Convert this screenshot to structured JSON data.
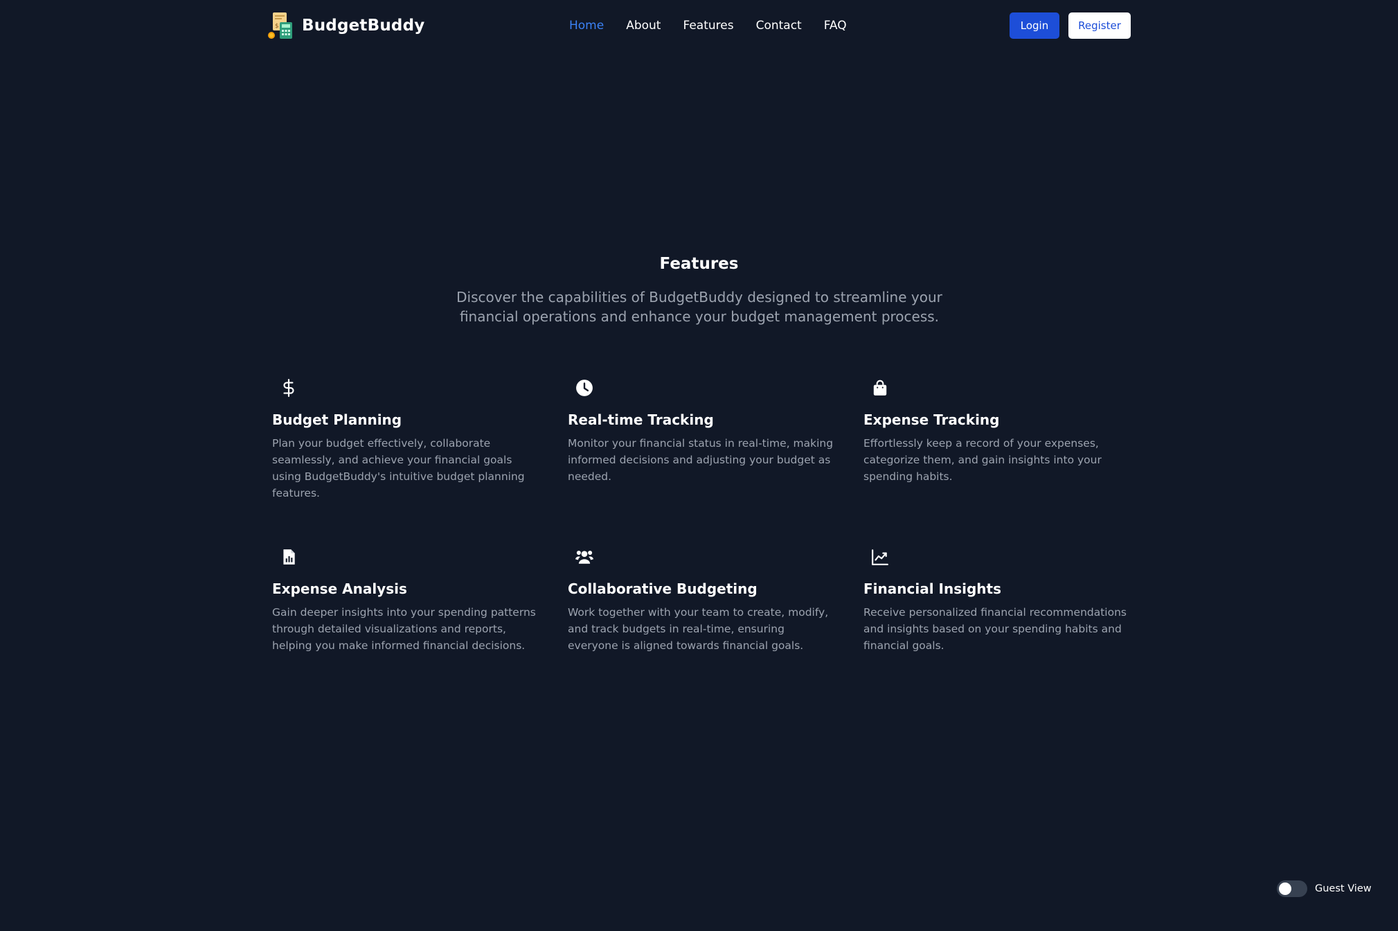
{
  "header": {
    "brand_name": "BudgetBuddy",
    "nav": [
      {
        "label": "Home",
        "active": true
      },
      {
        "label": "About",
        "active": false
      },
      {
        "label": "Features",
        "active": false
      },
      {
        "label": "Contact",
        "active": false
      },
      {
        "label": "FAQ",
        "active": false
      }
    ],
    "login_label": "Login",
    "register_label": "Register"
  },
  "features": {
    "title": "Features",
    "subtitle": "Discover the capabilities of BudgetBuddy designed to streamline your financial operations and enhance your budget management process.",
    "items": [
      {
        "icon": "dollar-icon",
        "title": "Budget Planning",
        "description": "Plan your budget effectively, collaborate seamlessly, and achieve your financial goals using BudgetBuddy's intuitive budget planning features."
      },
      {
        "icon": "clock-icon",
        "title": "Real-time Tracking",
        "description": "Monitor your financial status in real-time, making informed decisions and adjusting your budget as needed."
      },
      {
        "icon": "shopping-bag-icon",
        "title": "Expense Tracking",
        "description": "Effortlessly keep a record of your expenses, categorize them, and gain insights into your spending habits."
      },
      {
        "icon": "report-icon",
        "title": "Expense Analysis",
        "description": "Gain deeper insights into your spending patterns through detailed visualizations and reports, helping you make informed financial decisions."
      },
      {
        "icon": "users-icon",
        "title": "Collaborative Budgeting",
        "description": "Work together with your team to create, modify, and track budgets in real-time, ensuring everyone is aligned towards financial goals."
      },
      {
        "icon": "trending-up-icon",
        "title": "Financial Insights",
        "description": "Receive personalized financial recommendations and insights based on your spending habits and financial goals."
      }
    ]
  },
  "guest_view": {
    "label": "Guest View",
    "enabled": false
  },
  "colors": {
    "background": "#111827",
    "accent": "#1d4ed8",
    "nav_active": "#3b82f6",
    "muted_text": "#9ca3af"
  }
}
